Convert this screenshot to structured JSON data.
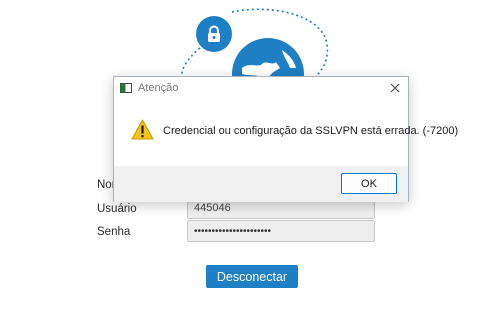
{
  "dialog": {
    "title": "Atenção",
    "message": "Credencial ou configuração da SSLVPN está errada. (-7200)",
    "ok_label": "OK"
  },
  "form": {
    "name_label": "Nom",
    "user_label": "Usuário",
    "user_value": "445046",
    "password_label": "Senha",
    "password_value": "••••••••••••••••••••••"
  },
  "actions": {
    "disconnect_label": "Desconectar"
  },
  "icons": {
    "lock": "lock-icon",
    "globe": "globe-icon",
    "warning": "warning-icon",
    "close": "close-icon",
    "app": "app-window-icon"
  },
  "colors": {
    "brand": "#1f7fc4",
    "warning": "#f2c318",
    "focus_border": "#0078d7"
  }
}
